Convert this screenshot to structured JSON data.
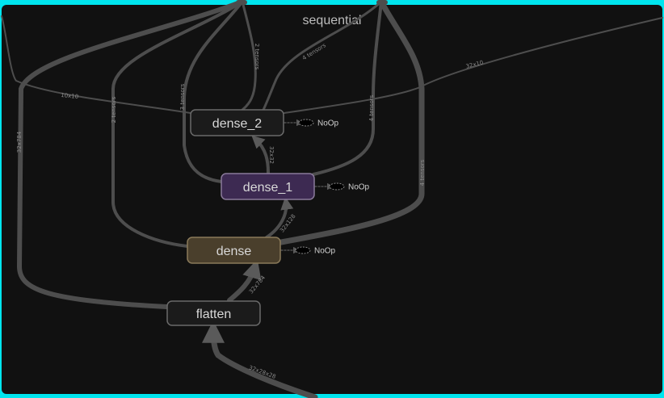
{
  "graph": {
    "title": "sequential",
    "nodes": {
      "dense_2": "dense_2",
      "dense_1": "dense_1",
      "dense": "dense",
      "flatten": "flatten"
    },
    "noop_label": "NoOp",
    "edge_labels": {
      "e_left_outer": "32x784",
      "e_left_mid": "2 tensors",
      "e_top_left": "10x10",
      "e_center_3t": "3 tensors",
      "e_center_2t": "2 tensors",
      "e_top_mid": "4 tensors",
      "e_right_4t": "4 tensors",
      "e_right_4t_b": "4 tensors",
      "e_top_right": "32x10",
      "e_d1_d2": "32x32",
      "e_d_d1": "32x128",
      "e_f_d": "32x784",
      "e_bottom": "32x28x28"
    },
    "colors": {
      "frame_border": "#00e5ee",
      "background": "#111111",
      "edge": "#4d4d4d",
      "node_border": "#6a6a6a",
      "dense_1_fill": "#3d2a52",
      "dense_fill": "#4a3f2c"
    }
  }
}
